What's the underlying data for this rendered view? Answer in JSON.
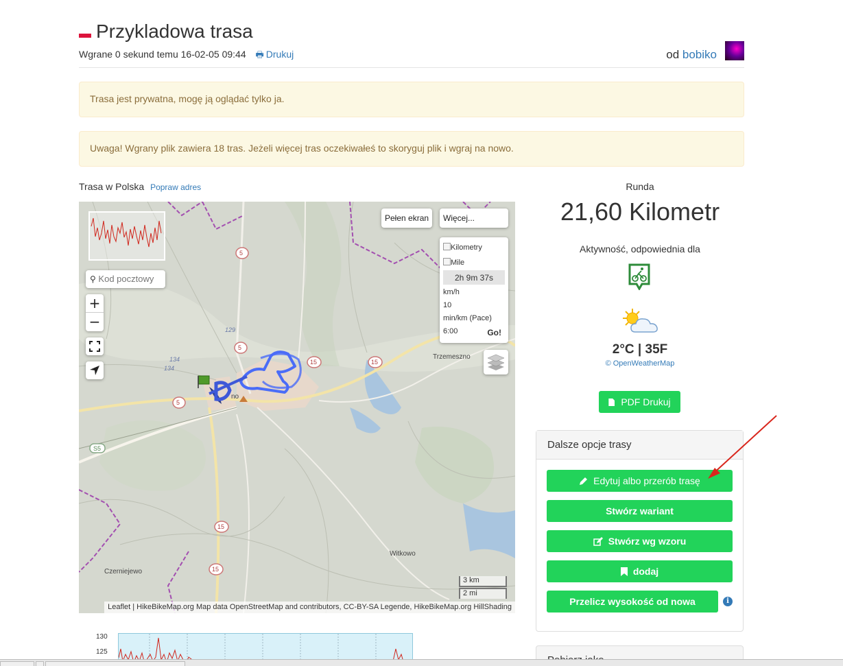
{
  "header": {
    "title": "Przykladowa trasa",
    "uploaded": "Wgrane 0 sekund temu 16-02-05 09:44",
    "print_label": "Drukuj",
    "author_prefix": "od",
    "author_name": "bobiko"
  },
  "alerts": {
    "private": "Trasa jest prywatna, mogę ją oglądać tylko ja.",
    "warning": "Uwaga! Wgrany plik zawiera 18 tras. Jeżeli więcej tras oczekiwałeś to skoryguj plik i wgraj na nowo."
  },
  "route": {
    "location": "Trasa w Polska",
    "fix_address": "Popraw adres"
  },
  "map": {
    "search_placeholder": "Kod pocztowy",
    "zoom_in": "+",
    "zoom_out": "−",
    "fullscreen_btn": "Pełen ekran",
    "more_btn": "Więcej...",
    "unit_km": "Kilometry",
    "unit_mi": "Mile",
    "duration": "2h 9m 37s",
    "speed_label": "km/h",
    "speed_value": "10",
    "pace_label": "min/km (Pace)",
    "pace_value": "6:00",
    "go_label": "Go!",
    "scale_km": "3 km",
    "scale_mi": "2 mi",
    "attribution": "Leaflet | HikeBikeMap.org Map data OpenStreetMap and contributors, CC-BY-SA Legende, HikeBikeMap.org HillShading",
    "place_labels": [
      "Trzemeszno",
      "Witkowo",
      "Czerniejewo",
      "no"
    ],
    "road_numbers": [
      "5",
      "5",
      "5",
      "15",
      "15",
      "15",
      "15",
      "S5",
      "129",
      "134",
      "134"
    ]
  },
  "elevation": {
    "ticks": [
      "130",
      "125"
    ]
  },
  "summary": {
    "type": "Runda",
    "distance": "21,60 Kilometr",
    "activity_label": "Aktywność, odpowiednia dla",
    "temperature": "2°C | 35F",
    "weather_source": "© OpenWeatherMap",
    "pdf_button": "PDF Drukuj"
  },
  "options": {
    "title": "Dalsze opcje trasy",
    "edit": "Edytuj albo przerób trasę",
    "variant": "Stwórz wariant",
    "template": "Stwórz wg wzoru",
    "add": "dodaj",
    "recalc": "Przelicz wysokość od nowa",
    "next_panel": "Pobierz jako"
  },
  "colors": {
    "accent_green": "#22d35a",
    "link_blue": "#337ab7",
    "alert_bg": "#fcf8e3",
    "route_blue": "#4a6cf7"
  }
}
